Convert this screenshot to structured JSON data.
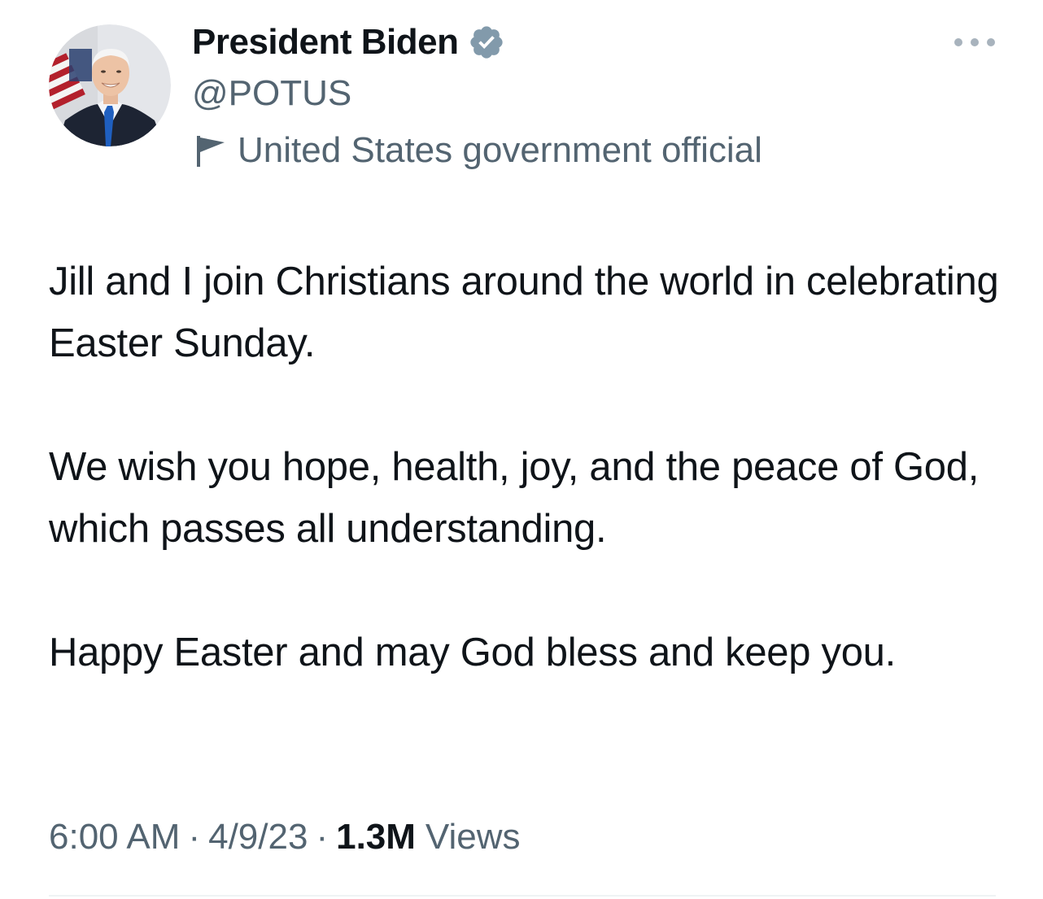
{
  "author": {
    "display_name": "President Biden",
    "handle": "@POTUS",
    "affiliation": "United States government official",
    "avatar_icon": "profile-photo",
    "verified_icon": "verified-badge-icon",
    "affiliation_icon": "flag-icon"
  },
  "tweet": {
    "paragraphs": [
      "Jill and I join Christians around the world in celebrating Easter Sunday.",
      "We wish you hope, health, joy, and the peace of God, which passes all understanding.",
      "Happy Easter and may God bless and keep you."
    ]
  },
  "meta": {
    "time": "6:00 AM",
    "separator": "·",
    "date": "4/9/23",
    "views_count": "1.3M",
    "views_label": "Views"
  },
  "colors": {
    "text_primary": "#0f1419",
    "text_secondary": "#536471",
    "verified_badge": "#829aab",
    "divider": "#eff3f4"
  }
}
